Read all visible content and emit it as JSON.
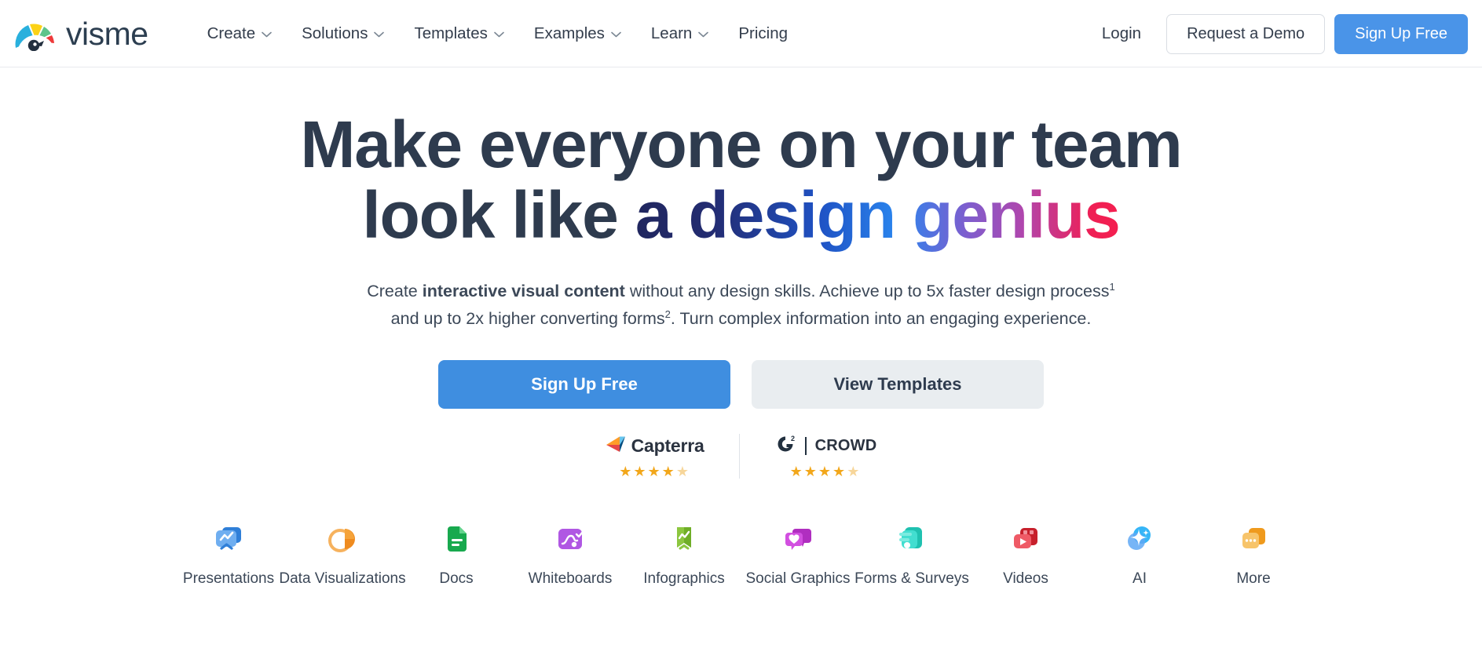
{
  "header": {
    "brand": {
      "name": "visme",
      "logo_icon": "visme-gauge-logo"
    },
    "nav": [
      {
        "label": "Create",
        "has_dropdown": true
      },
      {
        "label": "Solutions",
        "has_dropdown": true
      },
      {
        "label": "Templates",
        "has_dropdown": true
      },
      {
        "label": "Examples",
        "has_dropdown": true
      },
      {
        "label": "Learn",
        "has_dropdown": true
      },
      {
        "label": "Pricing",
        "has_dropdown": false
      }
    ],
    "login_label": "Login",
    "demo_label": "Request a Demo",
    "signup_label": "Sign Up Free"
  },
  "hero": {
    "headline_line1": "Make everyone on your team",
    "headline_line2_plain": "look like ",
    "headline_line2_gradient": "a design genius",
    "sub_line1_a": "Create ",
    "sub_line1_bold": "interactive visual content",
    "sub_line1_b": " without any design skills. Achieve up to 5x faster design process",
    "sub_line1_sup": "1",
    "sub_line2_a": "and up to 2x higher converting forms",
    "sub_line2_sup": "2",
    "sub_line2_b": ". Turn complex information into an engaging experience.",
    "cta_primary": "Sign Up Free",
    "cta_secondary": "View Templates"
  },
  "badges": [
    {
      "name": "Capterra",
      "logo_icon": "capterra-arrow-icon",
      "rating": 4.5,
      "stars_full": 4,
      "stars_half": 1
    },
    {
      "name": "CROWD",
      "prefix": "G2",
      "logo_icon": "g2-crowd-icon",
      "rating": 4.5,
      "stars_full": 4,
      "stars_half": 1
    }
  ],
  "features": [
    {
      "label": "Presentations",
      "icon": "presentations-icon",
      "color": "#3d8ae5"
    },
    {
      "label": "Data Visualizations",
      "icon": "data-visualizations-icon",
      "color": "#f08a1e"
    },
    {
      "label": "Docs",
      "icon": "docs-icon",
      "color": "#1fa84f"
    },
    {
      "label": "Whiteboards",
      "icon": "whiteboards-icon",
      "color": "#9b33d8"
    },
    {
      "label": "Infographics",
      "icon": "infographics-icon",
      "color": "#7cc523"
    },
    {
      "label": "Social Graphics",
      "icon": "social-graphics-icon",
      "color": "#c02fc9"
    },
    {
      "label": "Forms & Surveys",
      "icon": "forms-surveys-icon",
      "color": "#23c8b4"
    },
    {
      "label": "Videos",
      "icon": "videos-icon",
      "color": "#e8343f"
    },
    {
      "label": "AI",
      "icon": "ai-sparkle-icon",
      "color": "#2da4f5"
    },
    {
      "label": "More",
      "icon": "more-icon",
      "color": "#f0a022"
    }
  ],
  "colors": {
    "brand_blue": "#4a94e8",
    "text_dark": "#2e3b4e",
    "secondary_button": "#e9edf0",
    "star_gold": "#f2a71b"
  }
}
